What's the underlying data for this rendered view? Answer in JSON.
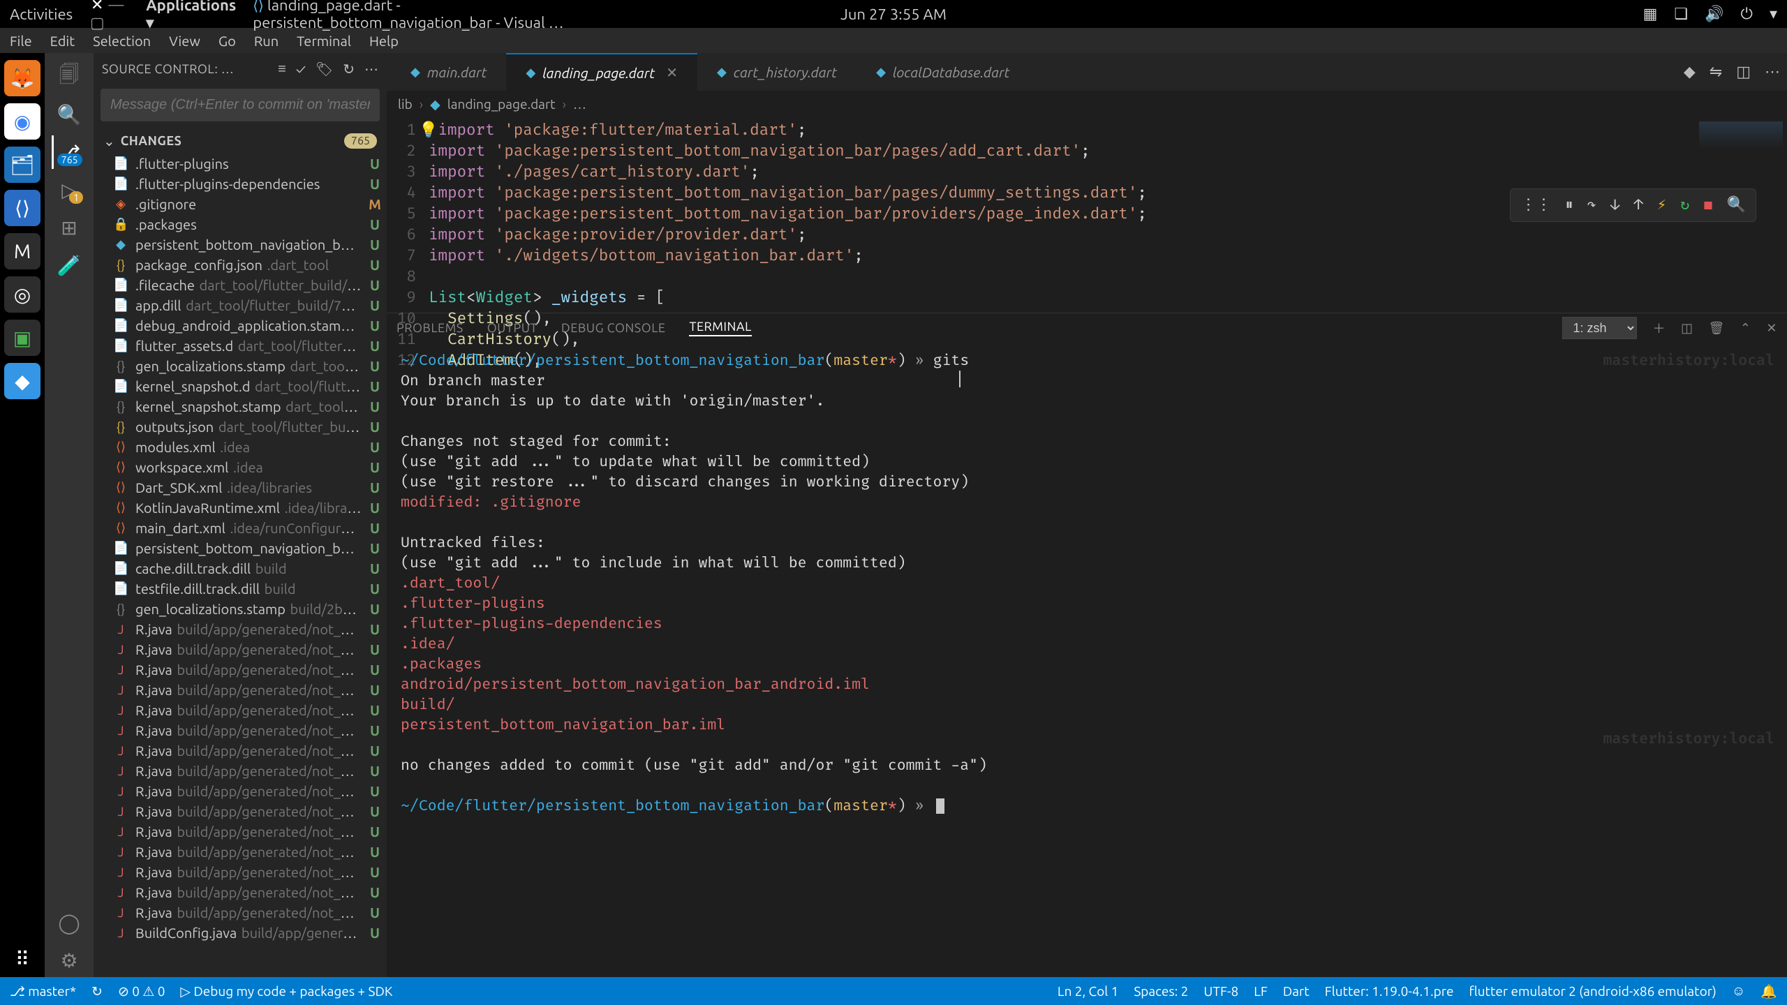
{
  "os": {
    "activities": "Activities",
    "applications": "Applications ▾",
    "windowTitle": "landing_page.dart - persistent_bottom_navigation_bar - Visual …",
    "clock": "Jun 27   3:55 AM",
    "tray": [
      "▦",
      "❏",
      "🔊",
      "⏻",
      "▾"
    ]
  },
  "menu": [
    "File",
    "Edit",
    "Selection",
    "View",
    "Go",
    "Run",
    "Terminal",
    "Help"
  ],
  "dock": [
    "🦊",
    "◉",
    "🗂",
    "⟨⟩",
    "M",
    "⚙",
    "▣",
    "◆"
  ],
  "activity": {
    "items": [
      {
        "icon": "🗐",
        "name": "explorer"
      },
      {
        "icon": "🔍",
        "name": "search"
      },
      {
        "icon": "⎇",
        "name": "scm",
        "active": true,
        "badge": "765"
      },
      {
        "icon": "▷",
        "name": "run-debug",
        "badge": "1"
      },
      {
        "icon": "⊞",
        "name": "extensions"
      },
      {
        "icon": "⚗",
        "name": "testing"
      }
    ],
    "bottom": [
      {
        "icon": "◯",
        "name": "account"
      },
      {
        "icon": "⚙",
        "name": "gear"
      }
    ]
  },
  "scm": {
    "title": "SOURCE CONTROL: …",
    "msgPlaceholder": "Message (Ctrl+Enter to commit on 'master')",
    "section": "CHANGES",
    "count": "765",
    "changes": [
      {
        "fi": "txt",
        "name": ".flutter-plugins",
        "sub": "",
        "stat": "U"
      },
      {
        "fi": "txt",
        "name": ".flutter-plugins-dependencies",
        "sub": "",
        "stat": "U"
      },
      {
        "fi": "git",
        "name": ".gitignore",
        "sub": "",
        "stat": "M"
      },
      {
        "fi": "lock",
        "name": ".packages",
        "sub": "",
        "stat": "U"
      },
      {
        "fi": "dart",
        "name": "persistent_bottom_navigation_bar.i…",
        "sub": "",
        "stat": "U"
      },
      {
        "fi": "json",
        "name": "package_config.json",
        "sub": ".dart_tool",
        "stat": "U"
      },
      {
        "fi": "txt",
        "name": ".filecache",
        "sub": "dart_tool/flutter_build/7cec…",
        "stat": "U"
      },
      {
        "fi": "txt",
        "name": "app.dill",
        "sub": "dart_tool/flutter_build/7ceca2…",
        "stat": "U"
      },
      {
        "fi": "txt",
        "name": "debug_android_application.stamp",
        "sub": "…",
        "stat": "U"
      },
      {
        "fi": "txt",
        "name": "flutter_assets.d",
        "sub": "dart_tool/flutter_buil…",
        "stat": "U"
      },
      {
        "fi": "stamp",
        "name": "gen_localizations.stamp",
        "sub": "dart_tool/fl…",
        "stat": "U"
      },
      {
        "fi": "txt",
        "name": "kernel_snapshot.d",
        "sub": "dart_tool/flutter_…",
        "stat": "U"
      },
      {
        "fi": "stamp",
        "name": "kernel_snapshot.stamp",
        "sub": "dart_tool/flutt…",
        "stat": "U"
      },
      {
        "fi": "json",
        "name": "outputs.json",
        "sub": "dart_tool/flutter_build/7…",
        "stat": "U"
      },
      {
        "fi": "xml",
        "name": "modules.xml",
        "sub": ".idea",
        "stat": "U"
      },
      {
        "fi": "xml",
        "name": "workspace.xml",
        "sub": ".idea",
        "stat": "U"
      },
      {
        "fi": "xml",
        "name": "Dart_SDK.xml",
        "sub": ".idea/libraries",
        "stat": "U"
      },
      {
        "fi": "xml",
        "name": "KotlinJavaRuntime.xml",
        "sub": ".idea/libraries",
        "stat": "U"
      },
      {
        "fi": "xml",
        "name": "main_dart.xml",
        "sub": ".idea/runConfigurations",
        "stat": "U"
      },
      {
        "fi": "txt",
        "name": "persistent_bottom_navigation_bar_…",
        "sub": "",
        "stat": "U"
      },
      {
        "fi": "txt",
        "name": "cache.dill.track.dill",
        "sub": "build",
        "stat": "U"
      },
      {
        "fi": "txt",
        "name": "testfile.dill.track.dill",
        "sub": "build",
        "stat": "U"
      },
      {
        "fi": "stamp",
        "name": "gen_localizations.stamp",
        "sub": "build/2b527e…",
        "stat": "U"
      },
      {
        "fi": "java",
        "name": "R.java",
        "sub": "build/app/generated/not_name…",
        "stat": "U"
      },
      {
        "fi": "java",
        "name": "R.java",
        "sub": "build/app/generated/not_name…",
        "stat": "U"
      },
      {
        "fi": "java",
        "name": "R.java",
        "sub": "build/app/generated/not_name…",
        "stat": "U"
      },
      {
        "fi": "java",
        "name": "R.java",
        "sub": "build/app/generated/not_name…",
        "stat": "U"
      },
      {
        "fi": "java",
        "name": "R.java",
        "sub": "build/app/generated/not_name…",
        "stat": "U"
      },
      {
        "fi": "java",
        "name": "R.java",
        "sub": "build/app/generated/not_name…",
        "stat": "U"
      },
      {
        "fi": "java",
        "name": "R.java",
        "sub": "build/app/generated/not_name…",
        "stat": "U"
      },
      {
        "fi": "java",
        "name": "R.java",
        "sub": "build/app/generated/not_name…",
        "stat": "U"
      },
      {
        "fi": "java",
        "name": "R.java",
        "sub": "build/app/generated/not_name…",
        "stat": "U"
      },
      {
        "fi": "java",
        "name": "R.java",
        "sub": "build/app/generated/not_name…",
        "stat": "U"
      },
      {
        "fi": "java",
        "name": "R.java",
        "sub": "build/app/generated/not_name…",
        "stat": "U"
      },
      {
        "fi": "java",
        "name": "R.java",
        "sub": "build/app/generated/not_name…",
        "stat": "U"
      },
      {
        "fi": "java",
        "name": "R.java",
        "sub": "build/app/generated/not_name…",
        "stat": "U"
      },
      {
        "fi": "java",
        "name": "R.java",
        "sub": "build/app/generated/not_name…",
        "stat": "U"
      },
      {
        "fi": "java",
        "name": "R.java",
        "sub": "build/app/generated/not_name…",
        "stat": "U"
      },
      {
        "fi": "java",
        "name": "BuildConfig.java",
        "sub": "build/app/generated…",
        "stat": "U"
      }
    ]
  },
  "tabs": [
    {
      "name": "main.dart",
      "active": false
    },
    {
      "name": "landing_page.dart",
      "active": true,
      "close": true
    },
    {
      "name": "cart_history.dart",
      "active": false
    },
    {
      "name": "localDatabase.dart",
      "active": false
    }
  ],
  "breadcrumb": {
    "a": "lib",
    "b": "landing_page.dart",
    "c": "…"
  },
  "code": {
    "lines": [
      1,
      2,
      3,
      4,
      5,
      6,
      7,
      8,
      9,
      10,
      11,
      12
    ],
    "src": [
      [
        "k",
        "import ",
        "s",
        "'package:flutter/material.dart'",
        "p",
        ";"
      ],
      [
        "k",
        "import ",
        "s",
        "'package:persistent_bottom_navigation_bar/pages/add_cart.dart'",
        "p",
        ";"
      ],
      [
        "k",
        "import ",
        "s",
        "'./pages/cart_history.dart'",
        "p",
        ";"
      ],
      [
        "k",
        "import ",
        "s",
        "'package:persistent_bottom_navigation_bar/pages/dummy_settings.dart'",
        "p",
        ";"
      ],
      [
        "k",
        "import ",
        "s",
        "'package:persistent_bottom_navigation_bar/providers/page_index.dart'",
        "p",
        ";"
      ],
      [
        "k",
        "import ",
        "s",
        "'package:provider/provider.dart'",
        "p",
        ";"
      ],
      [
        "k",
        "import ",
        "s",
        "'./widgets/bottom_navigation_bar.dart'",
        "p",
        ";"
      ],
      [
        "p",
        ""
      ],
      [
        "t",
        "List",
        "p",
        "<",
        "t",
        "Widget",
        "p",
        "> ",
        "v",
        "_widgets",
        "p",
        " = ["
      ],
      [
        "p",
        "  ",
        "fn",
        "Settings",
        "p",
        "(),"
      ],
      [
        "p",
        "  ",
        "fn",
        "CartHistory",
        "p",
        "(),"
      ],
      [
        "p",
        "  ",
        "fn",
        "AddItem",
        "p",
        "(),"
      ]
    ]
  },
  "panel": {
    "tabs": [
      "PROBLEMS",
      "OUTPUT",
      "DEBUG CONSOLE",
      "TERMINAL"
    ],
    "active": 3,
    "shell": "1: zsh"
  },
  "term": {
    "path": "~/Code/flutter/persistent_bottom_navigation_bar",
    "branch": "master",
    "star": "*",
    "marker": "»",
    "cmd": "gits",
    "wm1": "masterhistory:local",
    "wm2": "masterhistory:local",
    "lines": [
      "On branch master",
      "Your branch is up to date with 'origin/master'.",
      "",
      "Changes not staged for commit:",
      "  (use \"git add <file>...\" to update what will be committed)",
      "  (use \"git restore <file>...\" to discard changes in working directory)",
      "R|        modified:   .gitignore",
      "",
      "Untracked files:",
      "  (use \"git add <file>...\" to include in what will be committed)",
      "R|        .dart_tool/",
      "R|        .flutter-plugins",
      "R|        .flutter-plugins-dependencies",
      "R|        .idea/",
      "R|        .packages",
      "R|        android/persistent_bottom_navigation_bar_android.iml",
      "R|        build/",
      "R|        persistent_bottom_navigation_bar.iml",
      "",
      "no changes added to commit (use \"git add\" and/or \"git commit -a\")"
    ]
  },
  "status": {
    "left": [
      "⎇ master*",
      "↻",
      "⊘ 0 ⚠ 0",
      "▷ Debug my code + packages + SDK"
    ],
    "right": [
      "Ln 2, Col 1",
      "Spaces: 2",
      "UTF-8",
      "LF",
      "Dart",
      "Flutter: 1.19.0-4.1.pre",
      "flutter emulator 2 (android-x86 emulator)",
      "☺",
      "🔔"
    ]
  }
}
